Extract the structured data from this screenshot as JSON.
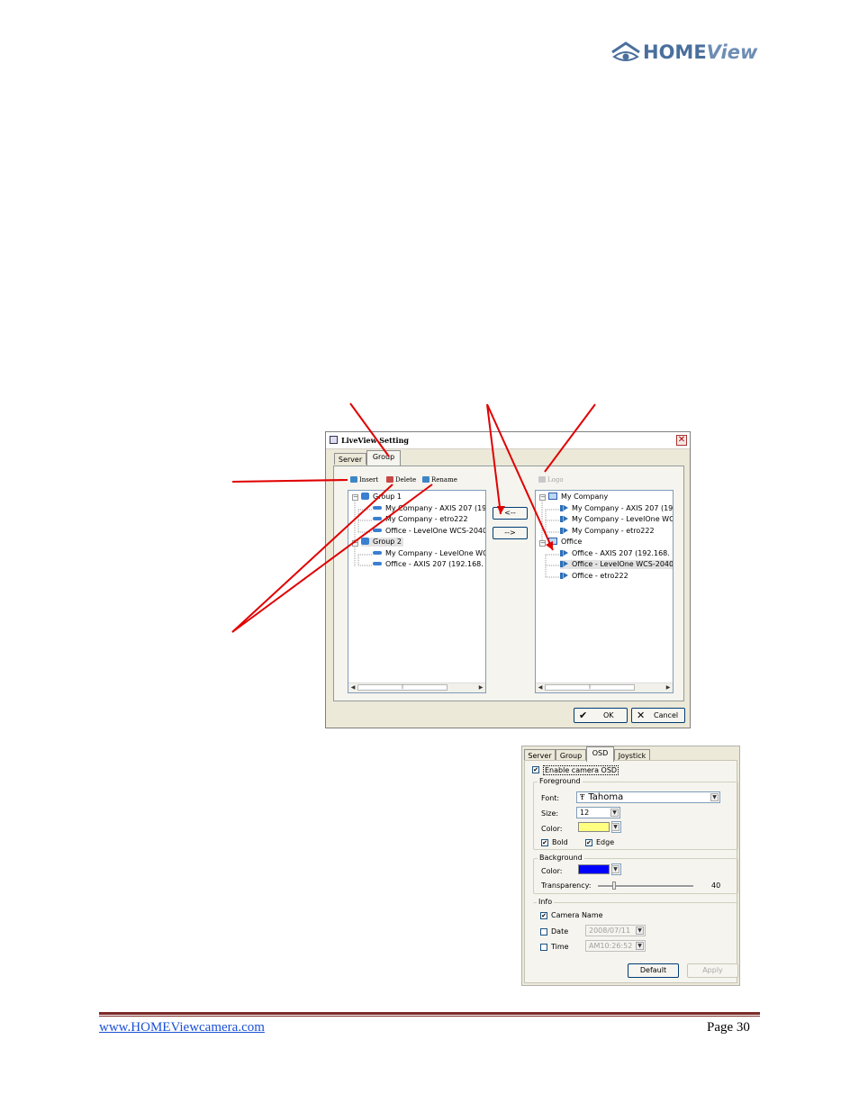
{
  "logo": {
    "brand_main": "HOME",
    "brand_italic": "View"
  },
  "liveview_dialog": {
    "title": "LiveView Setting",
    "close_symbol": "✕",
    "tabs": [
      "Server",
      "Group"
    ],
    "toolbar": {
      "insert": "Insert",
      "delete": "Delete",
      "rename": "Rename",
      "logo": "Logo"
    },
    "left_tree": {
      "group1": "Group 1",
      "group1_items": [
        "My Company - AXIS 207 (19",
        "My Company - etro222",
        "Office - LevelOne WCS-2040"
      ],
      "group2": "Group 2",
      "group2_items": [
        "My Company - LevelOne WC",
        "Office - AXIS 207 (192.168."
      ]
    },
    "right_tree": {
      "company": "My Company",
      "company_items": [
        "My Company - AXIS 207 (19",
        "My Company - LevelOne WC",
        "My Company - etro222"
      ],
      "office": "Office",
      "office_items": [
        "Office - AXIS 207 (192.168.",
        "Office - LevelOne WCS-2040",
        "Office - etro222"
      ]
    },
    "move_left_label": "<--",
    "move_right_label": "-->",
    "ok_label": "OK",
    "cancel_label": "Cancel"
  },
  "osd_dialog": {
    "tabs": [
      "Server",
      "Group",
      "OSD",
      "Joystick"
    ],
    "enable_label": "Enable camera OSD",
    "foreground": {
      "legend": "Foreground",
      "font_label": "Font:",
      "font_value": "Tahoma",
      "size_label": "Size:",
      "size_value": "12",
      "color_label": "Color:",
      "color_value": "#ffff80",
      "bold_label": "Bold",
      "edge_label": "Edge"
    },
    "background": {
      "legend": "Background",
      "color_label": "Color:",
      "color_value": "#0000ff",
      "transparency_label": "Transparency:",
      "transparency_value": "40"
    },
    "info": {
      "legend": "Info",
      "camera_name_label": "Camera Name",
      "date_label": "Date",
      "date_value": "2008/07/11",
      "time_label": "Time",
      "time_value": "AM10:26:52"
    },
    "default_label": "Default",
    "apply_label": "Apply"
  },
  "footer": {
    "link": "www.HOMEViewcamera.com",
    "page": "Page 30"
  },
  "colors": {
    "annotation": "#e00000",
    "footer_rule": "#7b2a27",
    "link": "#1a4fd6"
  }
}
